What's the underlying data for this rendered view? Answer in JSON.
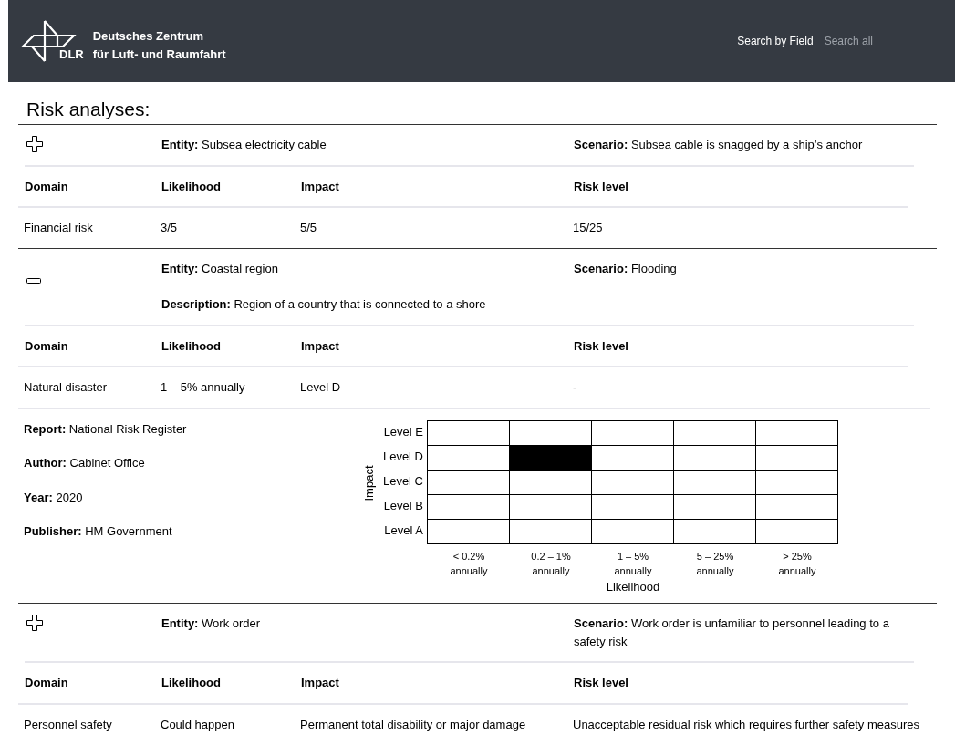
{
  "header": {
    "org_line1": "Deutsches Zentrum",
    "org_line2": "für Luft- und Raumfahrt",
    "logo_text": "DLR",
    "nav": [
      {
        "label": "Search by Field",
        "selected": true
      },
      {
        "label": "Search all",
        "selected": false
      }
    ]
  },
  "title": "Risk analyses:",
  "analyses": [
    {
      "expanded": false,
      "entity_label": "Entity:",
      "entity": "Subsea electricity cable",
      "scenario_label": "Scenario:",
      "scenario": "Subsea cable is snagged by a ship’s anchor",
      "columns": [
        "Domain",
        "Likelihood",
        "Impact",
        "Risk level"
      ],
      "row": [
        "Financial risk",
        "3/5",
        "5/5",
        "15/25"
      ]
    },
    {
      "expanded": true,
      "entity_label": "Entity:",
      "entity": "Coastal region",
      "scenario_label": "Scenario:",
      "scenario": "Flooding",
      "description_label": "Description:",
      "description": "Region of a country that is connected to  a shore",
      "columns": [
        "Domain",
        "Likelihood",
        "Impact",
        "Risk level"
      ],
      "row": [
        "Natural disaster",
        "1 – 5% annually",
        "Level D",
        "-"
      ],
      "details": [
        {
          "label": "Report:",
          "value": "National Risk Register"
        },
        {
          "label": "Author:",
          "value": "Cabinet Office"
        },
        {
          "label": "Year:",
          "value": "2020"
        },
        {
          "label": "Publisher:",
          "value": "HM Government"
        }
      ],
      "matrix": {
        "ylabel": "Impact",
        "xlabel": "Likelihood",
        "columns": [
          "< 0.2% annually",
          "0.2 – 1% annually",
          "1 – 5% annually",
          "5 – 25% annually",
          "> 25% annually"
        ],
        "rows": [
          {
            "label": "Level E",
            "cells": [
              {
                "selected": false
              },
              {
                "selected": false
              },
              {
                "selected": false
              },
              {
                "selected": false
              },
              {
                "selected": false
              }
            ]
          },
          {
            "label": "Level D",
            "cells": [
              {
                "selected": false
              },
              {
                "selected": true
              },
              {
                "selected": false
              },
              {
                "selected": false
              },
              {
                "selected": false
              }
            ]
          },
          {
            "label": "Level C",
            "cells": [
              {
                "selected": false
              },
              {
                "selected": false
              },
              {
                "selected": false
              },
              {
                "selected": false
              },
              {
                "selected": false
              }
            ]
          },
          {
            "label": "Level B",
            "cells": [
              {
                "selected": false
              },
              {
                "selected": false
              },
              {
                "selected": false
              },
              {
                "selected": false
              },
              {
                "selected": false
              }
            ]
          },
          {
            "label": "Level A",
            "cells": [
              {
                "selected": false
              },
              {
                "selected": false
              },
              {
                "selected": false
              },
              {
                "selected": false
              },
              {
                "selected": false
              }
            ]
          }
        ]
      }
    },
    {
      "expanded": false,
      "entity_label": "Entity:",
      "entity": "Work order",
      "scenario_label": "Scenario:",
      "scenario": "Work order is unfamiliar to personnel leading to a safety risk",
      "columns": [
        "Domain",
        "Likelihood",
        "Impact",
        "Risk level"
      ],
      "row": [
        "Personnel safety",
        "Could happen",
        "Permanent total disability or major damage",
        "Unacceptable residual risk which requires further safety measures"
      ]
    }
  ]
}
